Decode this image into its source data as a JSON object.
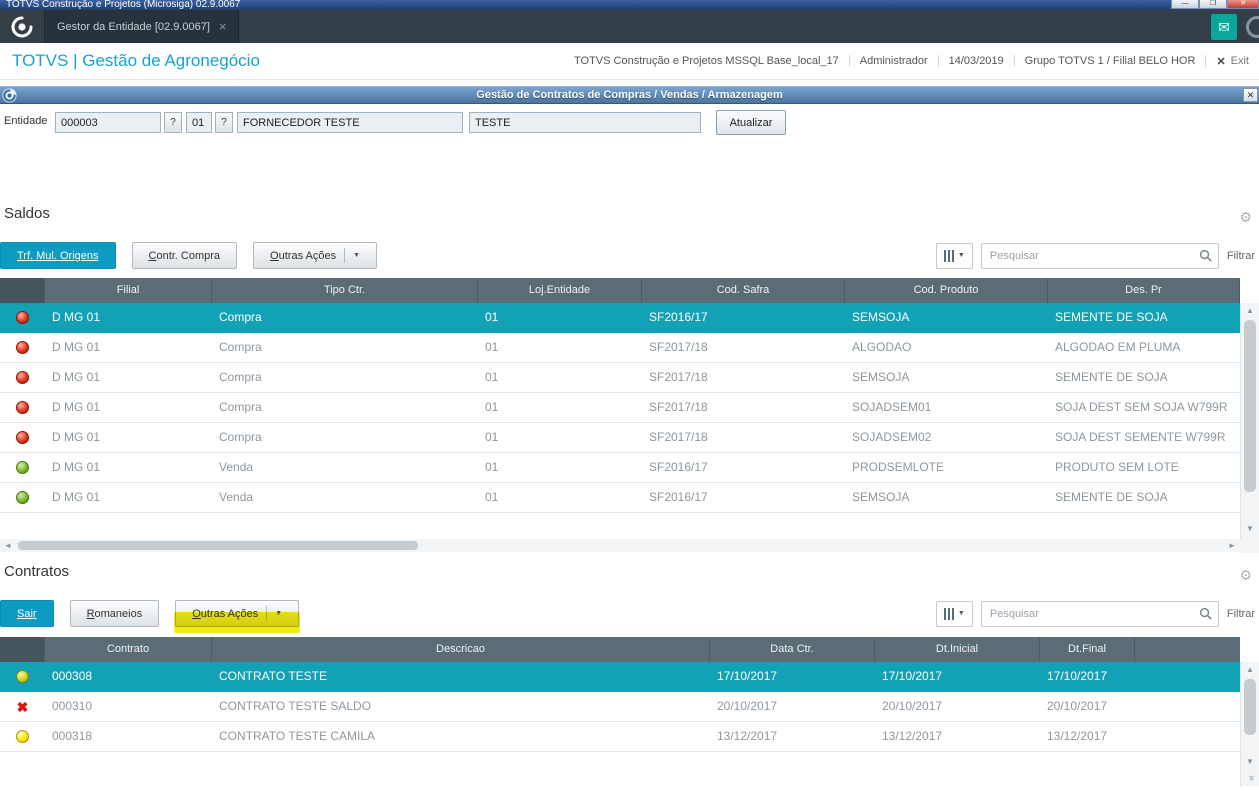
{
  "window": {
    "title": "TOTVS Construção e Projetos (Microsiga) 02.9.0067",
    "controls": {
      "minimize": "—",
      "maximize": "❐",
      "close": "✕"
    }
  },
  "tabbar": {
    "tab_label": "Gestor da Entidade [02.9.0067]",
    "tab_close": "×"
  },
  "app_header": {
    "brand": "TOTVS | Gestão de Agronegócio",
    "environment": "TOTVS Construção e Projetos MSSQL Base_local_17",
    "user": "Administrador",
    "date": "14/03/2019",
    "group_branch": "Grupo TOTVS 1 / Filial BELO HOR",
    "exit_icon": "✕",
    "exit_label": "Exit"
  },
  "dialog": {
    "title": "Gestão de Contratos de Compras / Vendas / Armazenagem",
    "close_icon": "✕"
  },
  "entity_form": {
    "label": "Entidade",
    "entity_code": "000003",
    "lookup_button": "?",
    "store_code": "01",
    "entity_name": "FORNECEDOR TESTE",
    "entity_desc": "TESTE",
    "update_button": "Atualizar"
  },
  "saldos": {
    "section_title": "Saldos",
    "toolbar": {
      "buttons": [
        {
          "label": "Trf. Mul. Origens",
          "primary": true
        },
        {
          "label": "Contr. Compra"
        },
        {
          "label": "Outras Ações",
          "caret": true
        }
      ],
      "search_placeholder": "Pesquisar",
      "filter_label": "Filtrar"
    },
    "columns": [
      "Filial",
      "Tipo Ctr.",
      "Loj.Entidade",
      "Cod. Safra",
      "Cod. Produto",
      "Des. Pr"
    ],
    "rows": [
      {
        "status": "red-ball",
        "selected": true,
        "cells": [
          "D MG 01",
          "Compra",
          "01",
          "SF2016/17",
          "SEMSOJA",
          "SEMENTE DE SOJA"
        ]
      },
      {
        "status": "red-ball",
        "cells": [
          "D MG 01",
          "Compra",
          "01",
          "SF2017/18",
          "ALGODAO",
          "ALGODAO EM PLUMA"
        ]
      },
      {
        "status": "red-ball",
        "cells": [
          "D MG 01",
          "Compra",
          "01",
          "SF2017/18",
          "SEMSOJA",
          "SEMENTE DE SOJA"
        ]
      },
      {
        "status": "red-ball",
        "cells": [
          "D MG 01",
          "Compra",
          "01",
          "SF2017/18",
          "SOJADSEM01",
          "SOJA DEST SEM SOJA W799R"
        ]
      },
      {
        "status": "red-ball",
        "cells": [
          "D MG 01",
          "Compra",
          "01",
          "SF2017/18",
          "SOJADSEM02",
          "SOJA DEST SEMENTE W799R"
        ]
      },
      {
        "status": "green-ball",
        "cells": [
          "D MG 01",
          "Venda",
          "01",
          "SF2016/17",
          "PRODSEMLOTE",
          "PRODUTO SEM LOTE"
        ]
      },
      {
        "status": "green-ball",
        "cells": [
          "D MG 01",
          "Venda",
          "01",
          "SF2016/17",
          "SEMSOJA",
          "SEMENTE DE SOJA"
        ]
      }
    ]
  },
  "contratos": {
    "section_title": "Contratos",
    "toolbar": {
      "buttons": [
        {
          "label": "Sair",
          "primary": true
        },
        {
          "label": "Romaneios"
        },
        {
          "label": "Outras Ações",
          "caret": true,
          "highlight": true
        }
      ],
      "search_placeholder": "Pesquisar",
      "filter_label": "Filtrar"
    },
    "columns": [
      "Contrato",
      "Descricao",
      "Data Ctr.",
      "Dt.Inicial",
      "Dt.Final"
    ],
    "rows": [
      {
        "status": "olive-ball",
        "selected": true,
        "cells": [
          "000308",
          "CONTRATO TESTE",
          "17/10/2017",
          "17/10/2017",
          "17/10/2017"
        ]
      },
      {
        "status": "red-x",
        "cells": [
          "000310",
          "CONTRATO TESTE SALDO",
          "20/10/2017",
          "20/10/2017",
          "20/10/2017"
        ]
      },
      {
        "status": "yellow-ball",
        "cells": [
          "000318",
          "CONTRATO TESTE CAMILA",
          "13/12/2017",
          "13/12/2017",
          "13/12/2017"
        ]
      }
    ]
  },
  "colors": {
    "brand_blue": "#1aa1cd",
    "primary_button": "#0d9bc4",
    "selected_row": "#13a1b6",
    "table_header": "#5c6c77",
    "highlight_yellow": "#f3ea16",
    "status_red": "#e03a25",
    "status_green": "#7cb832",
    "status_yellow": "#fbe904",
    "status_olive": "#cdd41e",
    "error_x": "#e01212"
  }
}
